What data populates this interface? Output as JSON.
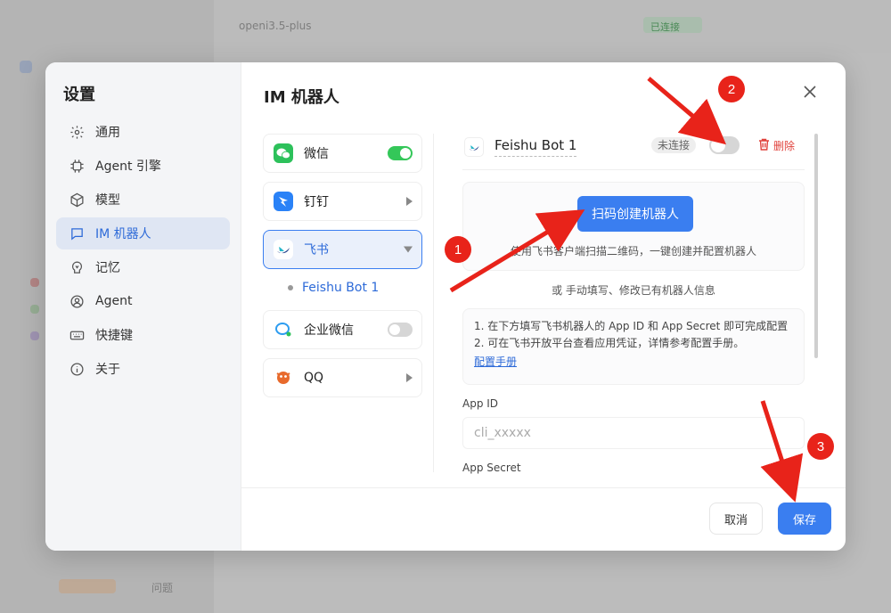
{
  "background": {
    "model_label": "openi3.5-plus",
    "badge_label": "已连接",
    "bottom_label": "问题"
  },
  "modal": {
    "sidebar_title": "设置",
    "nav": [
      {
        "label": "通用",
        "icon": "gear-icon"
      },
      {
        "label": "Agent 引擎",
        "icon": "chip-icon"
      },
      {
        "label": "模型",
        "icon": "cube-icon"
      },
      {
        "label": "IM 机器人",
        "icon": "chat-icon",
        "active": true
      },
      {
        "label": "记忆",
        "icon": "memory-icon"
      },
      {
        "label": "Agent",
        "icon": "agent-icon"
      },
      {
        "label": "快捷键",
        "icon": "keyboard-icon"
      },
      {
        "label": "关于",
        "icon": "info-icon"
      }
    ],
    "main_title": "IM 机器人",
    "platforms": [
      {
        "label": "微信",
        "control": "toggle-on",
        "color": "#2dc15b"
      },
      {
        "label": "钉钉",
        "control": "expand",
        "color": "#2a82f7"
      },
      {
        "label": "飞书",
        "control": "collapse",
        "color": "#ffffff",
        "active": true
      },
      {
        "label": "企业微信",
        "control": "toggle-off",
        "color": "#ffffff"
      },
      {
        "label": "QQ",
        "control": "expand",
        "color": "#ffffff"
      }
    ],
    "sub_bot": "Feishu Bot 1",
    "bot": {
      "name": "Feishu Bot 1",
      "status": "未连接",
      "delete_label": "删除"
    },
    "scan_button": "扫码创建机器人",
    "scan_hint": "使用飞书客户端扫描二维码，一键创建并配置机器人",
    "or_text": "或 手动填写、修改已有机器人信息",
    "info_lines": [
      "1. 在下方填写飞书机器人的 App ID 和 App Secret 即可完成配置",
      "2. 可在飞书开放平台查看应用凭证，详情参考配置手册。"
    ],
    "manual_link": "配置手册",
    "app_id_label": "App ID",
    "app_id_placeholder": "cli_xxxxx",
    "app_secret_label": "App Secret",
    "cancel_label": "取消",
    "save_label": "保存"
  },
  "annotations": [
    "1",
    "2",
    "3"
  ],
  "colors": {
    "accent": "#3a7ef0",
    "annotation": "#e8231a",
    "delete": "#e0423c"
  }
}
